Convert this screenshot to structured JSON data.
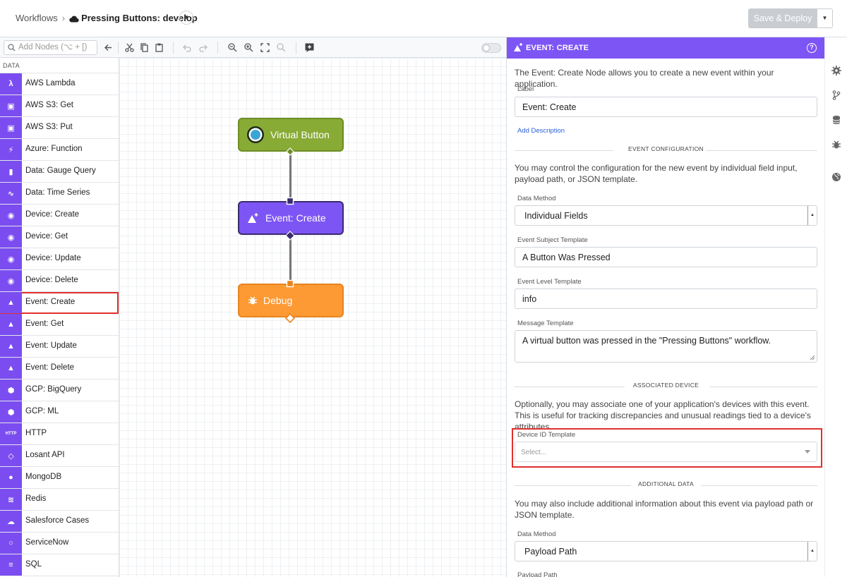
{
  "header": {
    "crumb_root": "Workflows",
    "separator": "›",
    "workflow_name": "Pressing Buttons: develop",
    "deploy_label": "Save & Deploy"
  },
  "toolbar": {
    "search_placeholder": "Add Nodes (⌥ + [)"
  },
  "palette": {
    "section": "DATA",
    "items": [
      {
        "label": "AWS Lambda",
        "icon": "aws-lambda-icon"
      },
      {
        "label": "AWS S3: Get",
        "icon": "bucket-icon"
      },
      {
        "label": "AWS S3: Put",
        "icon": "bucket-icon"
      },
      {
        "label": "Azure: Function",
        "icon": "azure-function-icon"
      },
      {
        "label": "Data: Gauge Query",
        "icon": "bar-chart-icon"
      },
      {
        "label": "Data: Time Series",
        "icon": "line-chart-icon"
      },
      {
        "label": "Device: Create",
        "icon": "device-icon"
      },
      {
        "label": "Device: Get",
        "icon": "device-icon"
      },
      {
        "label": "Device: Update",
        "icon": "device-icon"
      },
      {
        "label": "Device: Delete",
        "icon": "device-icon"
      },
      {
        "label": "Event: Create",
        "icon": "event-icon",
        "selected": true
      },
      {
        "label": "Event: Get",
        "icon": "event-icon"
      },
      {
        "label": "Event: Update",
        "icon": "event-icon"
      },
      {
        "label": "Event: Delete",
        "icon": "event-icon"
      },
      {
        "label": "GCP: BigQuery",
        "icon": "gcp-icon"
      },
      {
        "label": "GCP: ML",
        "icon": "gcp-icon"
      },
      {
        "label": "HTTP",
        "icon": "http-icon",
        "icon_text": "HTTP"
      },
      {
        "label": "Losant API",
        "icon": "losant-icon"
      },
      {
        "label": "MongoDB",
        "icon": "mongodb-icon"
      },
      {
        "label": "Redis",
        "icon": "redis-icon"
      },
      {
        "label": "Salesforce Cases",
        "icon": "salesforce-icon"
      },
      {
        "label": "ServiceNow",
        "icon": "servicenow-icon"
      },
      {
        "label": "SQL",
        "icon": "database-icon"
      }
    ]
  },
  "canvas": {
    "nodes": [
      {
        "label": "Virtual Button",
        "color": "#88ab35",
        "icon": "virtual-button-icon"
      },
      {
        "label": "Event: Create",
        "color": "#7e55f5",
        "icon": "event-icon"
      },
      {
        "label": "Debug",
        "color": "#fd9a33",
        "icon": "bug-icon"
      }
    ]
  },
  "panel": {
    "title": "EVENT: CREATE",
    "description": "The Event: Create Node allows you to create a new event within your application.",
    "label_label": "Label",
    "label_value": "Event: Create",
    "add_description": "Add Description",
    "event_config_heading": "EVENT CONFIGURATION",
    "event_config_text": "You may control the configuration for the new event by individual field input, payload path, or JSON template.",
    "data_method_label": "Data Method",
    "data_method_value": "Individual Fields",
    "subject_label": "Event Subject Template",
    "subject_value": "A Button Was Pressed",
    "level_label": "Event Level Template",
    "level_value": "info",
    "message_label": "Message Template",
    "message_value": "A virtual button was pressed in the \"Pressing Buttons\" workflow.",
    "assoc_heading": "ASSOCIATED DEVICE",
    "assoc_text": "Optionally, you may associate one of your application's devices with this event. This is useful for tracking discrepancies and unusual readings tied to a device's attributes.",
    "device_id_label": "Device ID Template",
    "device_id_placeholder": "Select...",
    "additional_heading": "ADDITIONAL DATA",
    "additional_text": "You may also include additional information about this event via payload path or JSON template.",
    "data_method2_label": "Data Method",
    "data_method2_value": "Payload Path",
    "payload_path_label": "Payload Path"
  },
  "colors": {
    "accent": "#7e55f5",
    "highlight": "#e0302b",
    "trigger": "#88ab35",
    "debug": "#fd9a33"
  }
}
